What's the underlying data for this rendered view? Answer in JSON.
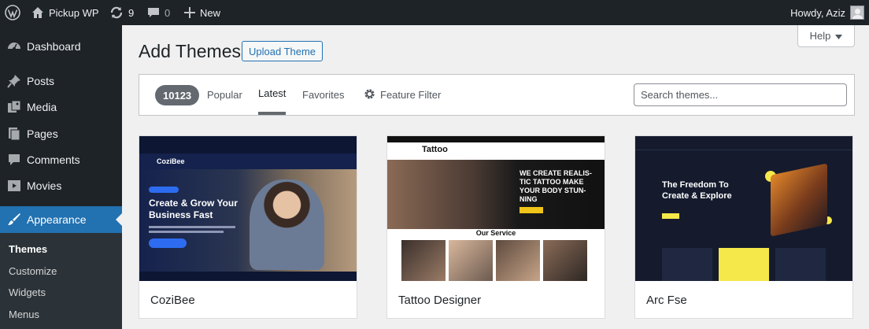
{
  "admin_bar": {
    "site_name": "Pickup WP",
    "updates_count": "9",
    "comments_count": "0",
    "new_label": "New",
    "howdy": "Howdy, Aziz"
  },
  "sidebar": {
    "items": [
      {
        "label": "Dashboard",
        "icon": "dashboard-icon"
      },
      {
        "label": "Posts",
        "icon": "pin-icon"
      },
      {
        "label": "Media",
        "icon": "media-icon"
      },
      {
        "label": "Pages",
        "icon": "pages-icon"
      },
      {
        "label": "Comments",
        "icon": "comments-icon"
      },
      {
        "label": "Movies",
        "icon": "movies-icon"
      },
      {
        "label": "Appearance",
        "icon": "brush-icon",
        "active": true
      }
    ],
    "submenu": [
      "Themes",
      "Customize",
      "Widgets",
      "Menus"
    ],
    "current_submenu": "Themes"
  },
  "header": {
    "title": "Add Themes",
    "upload_label": "Upload Theme",
    "help_label": "Help"
  },
  "filter_bar": {
    "count": "10123",
    "tabs": [
      "Popular",
      "Latest",
      "Favorites"
    ],
    "current_tab": "Latest",
    "feature_filter": "Feature Filter",
    "search_placeholder": "Search themes..."
  },
  "themes": [
    {
      "name": "CoziBee",
      "logo": "CoziBee",
      "hero_text": "Create & Grow Your Business Fast"
    },
    {
      "name": "Tattoo Designer",
      "logo": "Tattoo",
      "hero_text": "WE CREATE REALIS-TIC TATTOO MAKE YOUR BODY STUN-NING",
      "section_title": "Our Service"
    },
    {
      "name": "Arc Fse",
      "hero_text": "The Freedom To Create & Explore"
    }
  ],
  "colors": {
    "admin_dark": "#1d2327",
    "accent": "#2271b1",
    "page_bg": "#f0f0f1"
  }
}
